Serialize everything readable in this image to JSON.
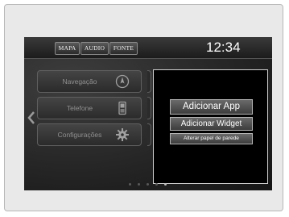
{
  "header": {
    "tabs": [
      {
        "label": "MAPA"
      },
      {
        "label": "AUDIO"
      },
      {
        "label": "FONTE"
      }
    ],
    "clock": "12:34"
  },
  "home_menu": {
    "items": [
      {
        "label": "Navegação",
        "icon": "compass-icon"
      },
      {
        "label": "Telefone",
        "icon": "phone-icon"
      },
      {
        "label": "Configurações",
        "icon": "gear-icon"
      }
    ],
    "left_arrow_icon": "chevron-left-icon"
  },
  "popup": {
    "add_app": "Adicionar App",
    "add_widget": "Adicionar Widget",
    "change_wallpaper": "Alterar papel de parede"
  },
  "pager": {
    "page_count": 5,
    "active_page": 4
  },
  "colors": {
    "screen_background": "#1a1a1a",
    "popup_background": "#000000",
    "menu_text": "#909090",
    "accent_text": "#ffffff"
  }
}
